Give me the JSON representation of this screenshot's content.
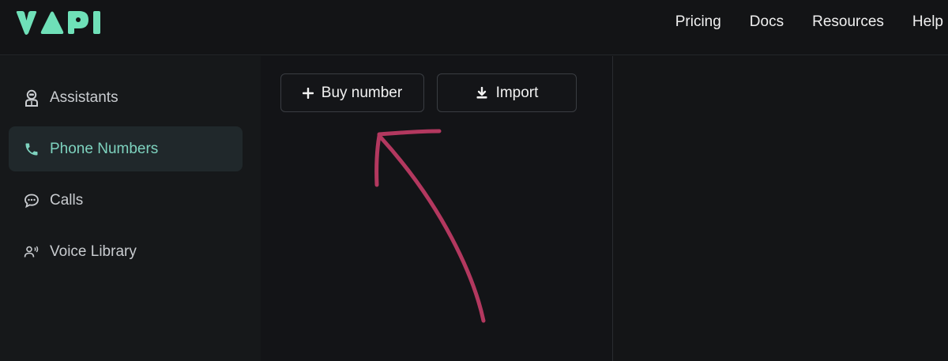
{
  "header": {
    "logo_text": "VAPI",
    "nav": [
      "Pricing",
      "Docs",
      "Resources",
      "Help"
    ]
  },
  "sidebar": {
    "items": [
      {
        "label": "Assistants",
        "icon": "robot-icon"
      },
      {
        "label": "Phone Numbers",
        "icon": "phone-icon",
        "active": true
      },
      {
        "label": "Calls",
        "icon": "chat-bubble-icon"
      },
      {
        "label": "Voice Library",
        "icon": "voice-user-icon"
      }
    ]
  },
  "main": {
    "buy_number_label": "Buy number",
    "import_label": "Import"
  },
  "colors": {
    "brand": "#6fe0b8",
    "active_text": "#7ed3bf",
    "arrow": "#b3385f"
  }
}
